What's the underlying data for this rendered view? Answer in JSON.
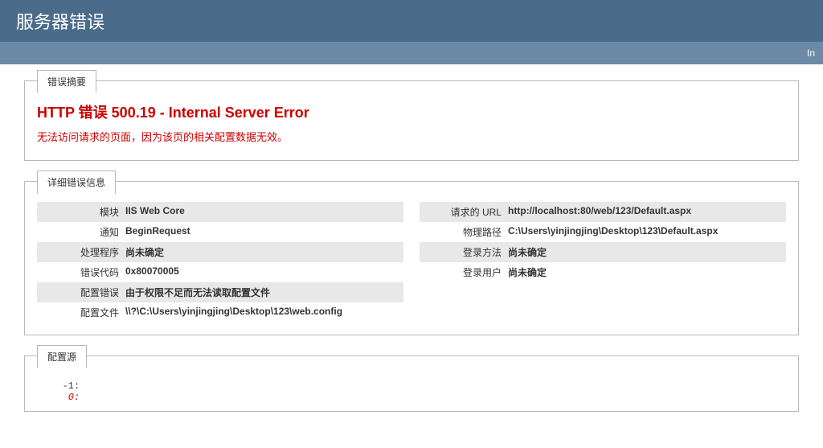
{
  "header": {
    "title": "服务器错误",
    "subbar_text": "In"
  },
  "summary": {
    "tab_label": "错误摘要",
    "error_title": "HTTP 错误 500.19 - Internal Server Error",
    "error_desc": "无法访问请求的页面，因为该页的相关配置数据无效。"
  },
  "details": {
    "tab_label": "详细错误信息",
    "left": [
      {
        "label": "模块",
        "value": "IIS Web Core"
      },
      {
        "label": "通知",
        "value": "BeginRequest"
      },
      {
        "label": "处理程序",
        "value": "尚未确定"
      },
      {
        "label": "错误代码",
        "value": "0x80070005"
      },
      {
        "label": "配置错误",
        "value": "由于权限不足而无法读取配置文件"
      },
      {
        "label": "配置文件",
        "value": "\\\\?\\C:\\Users\\yinjingjing\\Desktop\\123\\web.config"
      }
    ],
    "right": [
      {
        "label": "请求的 URL",
        "value": "http://localhost:80/web/123/Default.aspx"
      },
      {
        "label": "物理路径",
        "value": "C:\\Users\\yinjingjing\\Desktop\\123\\Default.aspx"
      },
      {
        "label": "登录方法",
        "value": "尚未确定"
      },
      {
        "label": "登录用户",
        "value": "尚未确定"
      }
    ]
  },
  "config_source": {
    "tab_label": "配置源",
    "line1": "   -1: ",
    "line2": "    0: "
  }
}
